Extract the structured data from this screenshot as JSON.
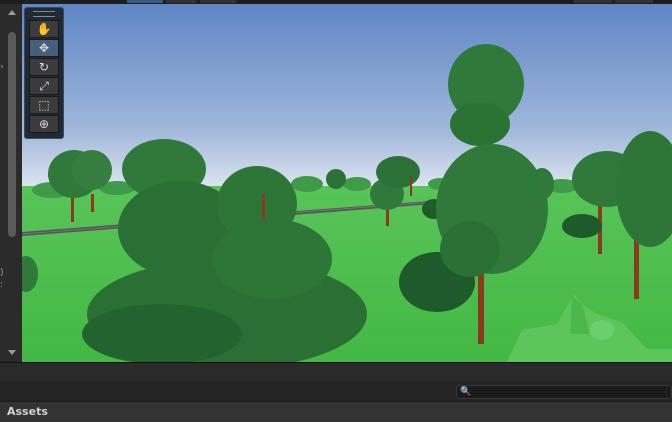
{
  "scene_view": {
    "tools": [
      {
        "name": "hand-tool",
        "icon": "hand-icon",
        "glyph": "✋",
        "active": false
      },
      {
        "name": "move-tool",
        "icon": "move-arrows-icon",
        "glyph": "✥",
        "active": true
      },
      {
        "name": "rotate-tool",
        "icon": "rotate-icon",
        "glyph": "↻",
        "active": false
      },
      {
        "name": "scale-tool",
        "icon": "scale-icon",
        "glyph": "⤢",
        "active": false
      },
      {
        "name": "rect-tool",
        "icon": "rect-transform-icon",
        "glyph": "⬚",
        "active": false
      },
      {
        "name": "transform-tool",
        "icon": "transform-icon",
        "glyph": "⊕",
        "active": false
      }
    ]
  },
  "left_panel": {
    "fragments": [
      ")",
      ":"
    ]
  },
  "search": {
    "icon": "search-icon",
    "glyph": "🔍"
  },
  "project_panel": {
    "assets_label": "Assets"
  },
  "colors": {
    "editor_bg": "#282828",
    "sky_top": "#5f86c5",
    "sky_horizon": "#dde6f2",
    "grass": "#4fc24f",
    "tree_foliage": "#2f7a3a",
    "trunk": "#8b3a1e",
    "accent_active_tool": "#46607c"
  }
}
